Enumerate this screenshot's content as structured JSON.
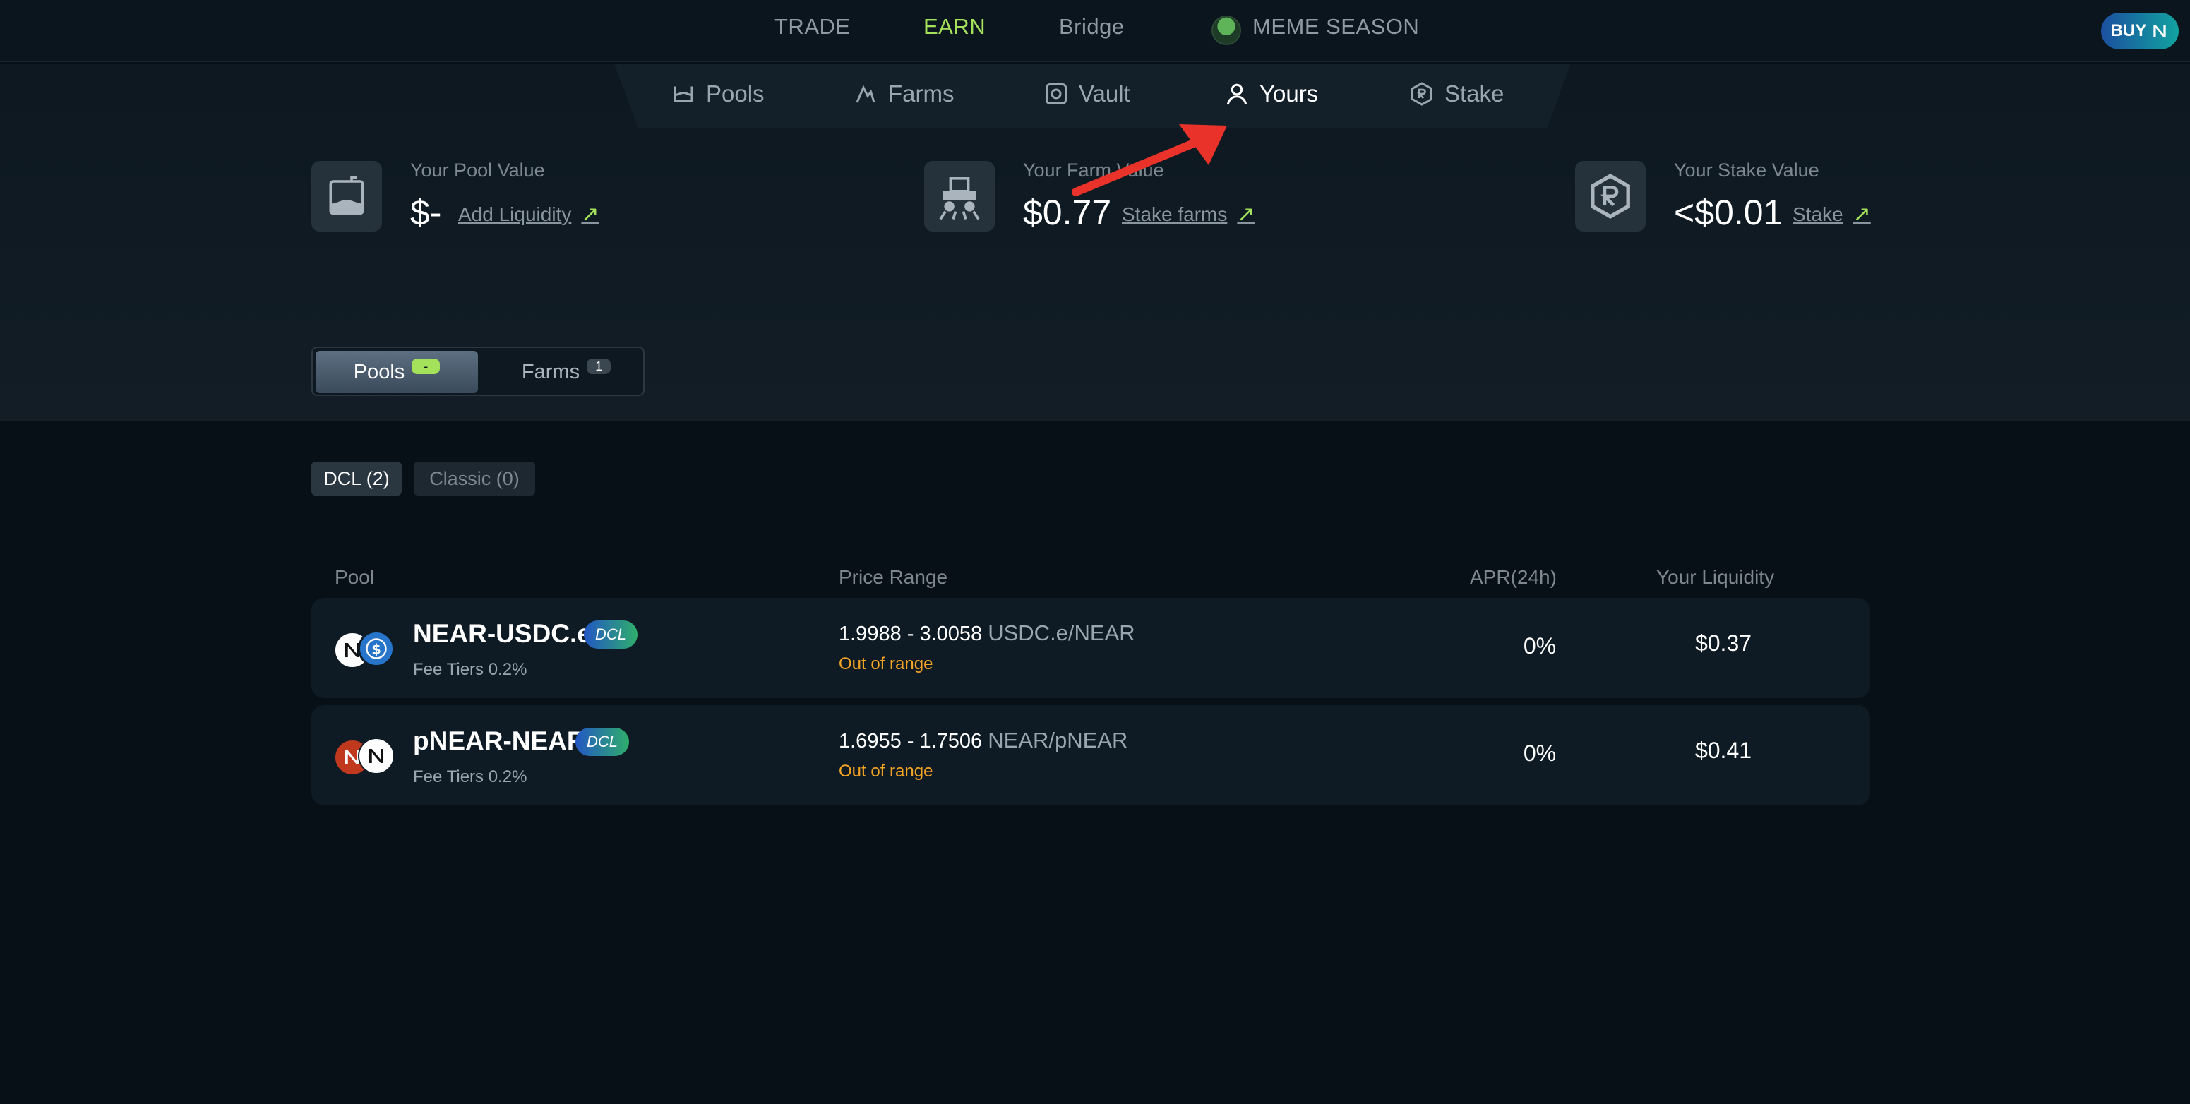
{
  "topnav": {
    "trade": "TRADE",
    "earn": "EARN",
    "bridge": "Bridge",
    "meme": "MEME SEASON",
    "buy": "BUY"
  },
  "subnav": {
    "pools": "Pools",
    "farms": "Farms",
    "vault": "Vault",
    "yours": "Yours",
    "stake": "Stake",
    "active": "Yours"
  },
  "stats": {
    "pool": {
      "label": "Your Pool Value",
      "value": "$-",
      "link": "Add Liquidity"
    },
    "farm": {
      "label": "Your Farm Value",
      "value": "$0.77",
      "link": "Stake farms"
    },
    "stake": {
      "label": "Your Stake Value",
      "value": "<$0.01",
      "link": "Stake"
    }
  },
  "toggle": {
    "pools_label": "Pools",
    "pools_badge": "-",
    "farms_label": "Farms",
    "farms_badge": "1"
  },
  "segments": {
    "dcl": "DCL (2)",
    "classic": "Classic (0)"
  },
  "table": {
    "headers": {
      "pool": "Pool",
      "price_range": "Price Range",
      "apr": "APR(24h)",
      "liquidity": "Your Liquidity"
    },
    "rows": [
      {
        "pair": "NEAR-USDC.e",
        "badge": "DCL",
        "fee": "Fee Tiers 0.2%",
        "range": "1.9988 - 3.0058",
        "unit": "USDC.e/NEAR",
        "status": "Out of range",
        "apr": "0%",
        "liquidity": "$0.37"
      },
      {
        "pair": "pNEAR-NEAR",
        "badge": "DCL",
        "fee": "Fee Tiers 0.2%",
        "range": "1.6955 - 1.7506",
        "unit": "NEAR/pNEAR",
        "status": "Out of range",
        "apr": "0%",
        "liquidity": "$0.41"
      }
    ]
  },
  "colors": {
    "accent": "#a4e25c",
    "background": "#071017",
    "warning": "#f5a524",
    "annotation": "#e8322a"
  }
}
